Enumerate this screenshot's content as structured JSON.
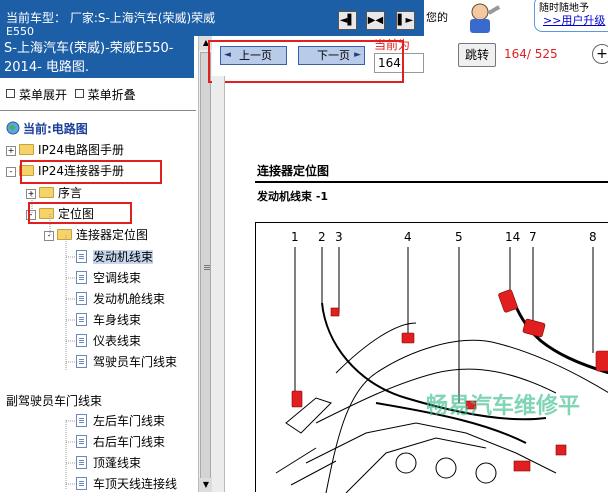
{
  "top_bar": {
    "car_type_line1": "当前车型：  厂家:S-上海汽车(荣威)荣威",
    "car_type_line2": "E550",
    "nav_buttons": [
      "◄▌",
      "▶◀",
      "▌►"
    ],
    "right_text": "您的",
    "bubble_line1": "随时随地予",
    "bubble_link": ">>用户升级"
  },
  "sidebar": {
    "title": "S-上海汽车(荣威)-荣威E550-2014- 电路图.",
    "expand_label": "菜单展开",
    "collapse_label": "菜单折叠",
    "current_label": "当前:电路图",
    "tree": [
      {
        "label": "IP24电路图手册"
      },
      {
        "label": "IP24连接器手册"
      },
      {
        "label": "序言"
      },
      {
        "label": "定位图"
      },
      {
        "label": "连接器定位图"
      },
      {
        "label": "发动机线束"
      },
      {
        "label": "空调线束"
      },
      {
        "label": "发动机舱线束"
      },
      {
        "label": "车身线束"
      },
      {
        "label": "仪表线束"
      },
      {
        "label": "驾驶员车门线束"
      },
      {
        "label": "副驾驶员车门线束"
      },
      {
        "label": "左后车门线束"
      },
      {
        "label": "右后车门线束"
      },
      {
        "label": "顶蓬线束"
      },
      {
        "label": "车顶天线连接线"
      }
    ]
  },
  "toolbar": {
    "prev_label": "上一页",
    "next_label": "下一页",
    "current_page_label": "当前为",
    "page_value": "164",
    "jump_label": "跳转",
    "page_count": "164/ 525",
    "zoom_icon": "+"
  },
  "document": {
    "title": "连接器定位图",
    "subtitle": "发动机线束 -1",
    "callouts": [
      "1",
      "2",
      "3",
      "4",
      "5",
      "14",
      "7",
      "8"
    ],
    "watermark": "畅易汽车维修平"
  },
  "colors": {
    "header_blue": "#1c5fa6",
    "highlight_red": "#e02020",
    "selected_bg": "#c6d7ee"
  }
}
